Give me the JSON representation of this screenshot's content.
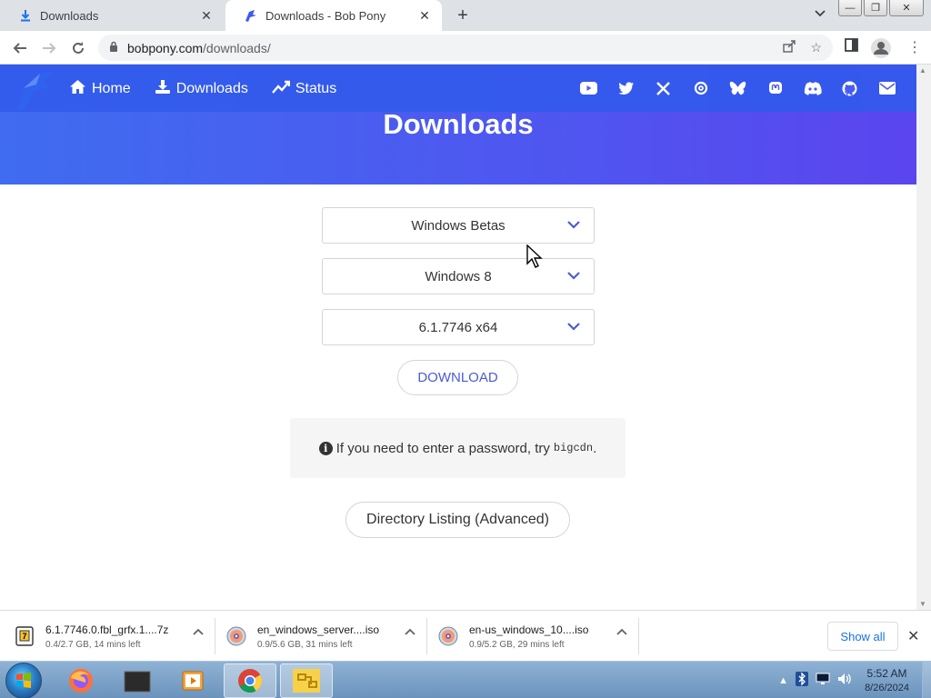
{
  "browser": {
    "tabs": [
      {
        "title": "Downloads",
        "icon": "download-icon",
        "active": false
      },
      {
        "title": "Downloads - Bob Pony",
        "icon": "bobpony-logo-icon",
        "active": true
      }
    ],
    "url": {
      "host": "bobpony.com",
      "path": "/downloads/"
    }
  },
  "site": {
    "nav": [
      {
        "label": "Home",
        "icon": "home-icon"
      },
      {
        "label": "Downloads",
        "icon": "download-icon"
      },
      {
        "label": "Status",
        "icon": "chart-line-icon"
      }
    ],
    "socials": [
      "youtube-icon",
      "twitter-icon",
      "x-icon",
      "threads-icon",
      "bluesky-icon",
      "mastodon-icon",
      "discord-icon",
      "github-icon",
      "email-icon"
    ],
    "colors": {
      "hero_start": "#3f6cf0",
      "hero_end": "#5a45ee",
      "accent": "#4b5bd4"
    }
  },
  "page": {
    "title": "Downloads",
    "selects": [
      {
        "value": "Windows Betas"
      },
      {
        "value": "Windows 8"
      },
      {
        "value": "6.1.7746 x64"
      }
    ],
    "download_label": "DOWNLOAD",
    "notice": {
      "text": "If you need to enter a password, try",
      "code": "bigcdn",
      "suffix": "."
    },
    "directory_label": "Directory Listing (Advanced)"
  },
  "shelf": {
    "items": [
      {
        "name": "6.1.7746.0.fbl_grfx.1....7z",
        "status": "0.4/2.7 GB, 14 mins left",
        "icon": "archive-file-icon"
      },
      {
        "name": "en_windows_server....iso",
        "status": "0.9/5.6 GB, 31 mins left",
        "icon": "disc-image-icon"
      },
      {
        "name": "en-us_windows_10....iso",
        "status": "0.9/5.2 GB, 29 mins left",
        "icon": "disc-image-icon"
      }
    ],
    "show_all": "Show all"
  },
  "taskbar": {
    "apps": [
      "firefox-icon",
      "terminal-icon",
      "media-player-icon",
      "chrome-icon",
      "network-app-icon"
    ],
    "time": "5:52 AM",
    "date": "8/26/2024"
  }
}
